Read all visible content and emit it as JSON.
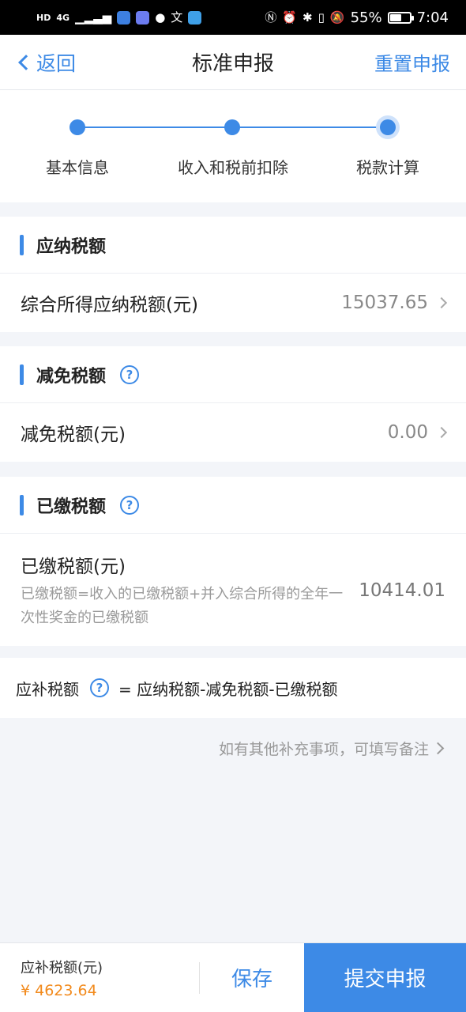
{
  "status_bar": {
    "left_tags": [
      "HD",
      "4G"
    ],
    "signal": "▁▂▃▅",
    "battery_percent": "55%",
    "battery_level": 0.55,
    "time": "7:04",
    "icons": [
      "nfc-icon",
      "alarm-icon",
      "bluetooth-icon",
      "vibrate-icon",
      "mute-bell-icon",
      "battery-icon"
    ]
  },
  "nav": {
    "back_label": "返回",
    "title": "标准申报",
    "action_label": "重置申报"
  },
  "steps": [
    {
      "label": "基本信息"
    },
    {
      "label": "收入和税前扣除"
    },
    {
      "label": "税款计算"
    }
  ],
  "sections": {
    "payable": {
      "title": "应纳税额",
      "row_label": "综合所得应纳税额(元)",
      "row_value": "15037.65"
    },
    "relief": {
      "title": "减免税额",
      "row_label": "减免税额(元)",
      "row_value": "0.00"
    },
    "paid": {
      "title": "已缴税额",
      "row_label": "已缴税额(元)",
      "row_desc": "已缴税额=收入的已缴税额+并入综合所得的全年一次性奖金的已缴税额",
      "row_value": "10414.01"
    }
  },
  "formula": {
    "label": "应补税额",
    "expression": "= 应纳税额-减免税额-已缴税额"
  },
  "note_link": "如有其他补充事项，可填写备注",
  "bottom": {
    "amount_label": "应补税额(元)",
    "amount_value": "¥ 4623.64",
    "save_label": "保存",
    "submit_label": "提交申报"
  },
  "colors": {
    "accent": "#3d8ae6",
    "amount": "#f28a1c"
  }
}
